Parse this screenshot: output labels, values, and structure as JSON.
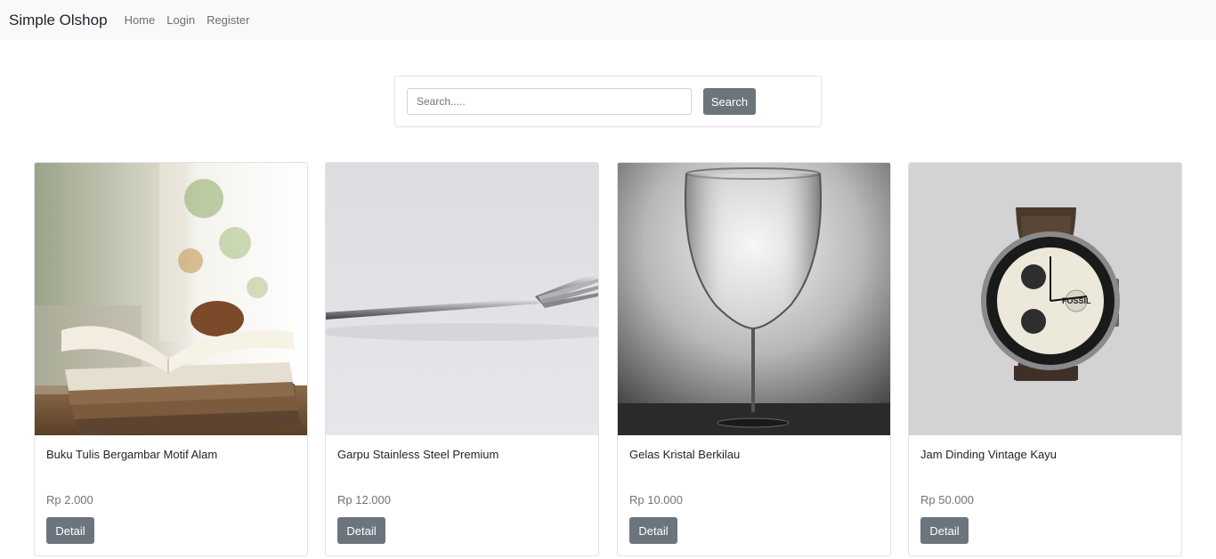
{
  "navbar": {
    "brand": "Simple Olshop",
    "links": [
      "Home",
      "Login",
      "Register"
    ]
  },
  "search": {
    "placeholder": "Search.....",
    "button_label": "Search"
  },
  "products": [
    {
      "name": "Buku Tulis Bergambar Motif Alam",
      "price": "Rp 2.000",
      "button_label": "Detail",
      "image": "book-image"
    },
    {
      "name": "Garpu Stainless Steel Premium",
      "price": "Rp 12.000",
      "button_label": "Detail",
      "image": "fork-image"
    },
    {
      "name": "Gelas Kristal Berkilau",
      "price": "Rp 10.000",
      "button_label": "Detail",
      "image": "wine-glass-image"
    },
    {
      "name": "Jam Dinding Vintage Kayu",
      "price": "Rp 50.000",
      "button_label": "Detail",
      "image": "watch-image"
    }
  ],
  "colors": {
    "navbar_bg": "#f8f9fa",
    "button_secondary": "#6c757d",
    "border": "#dfe2e6"
  }
}
